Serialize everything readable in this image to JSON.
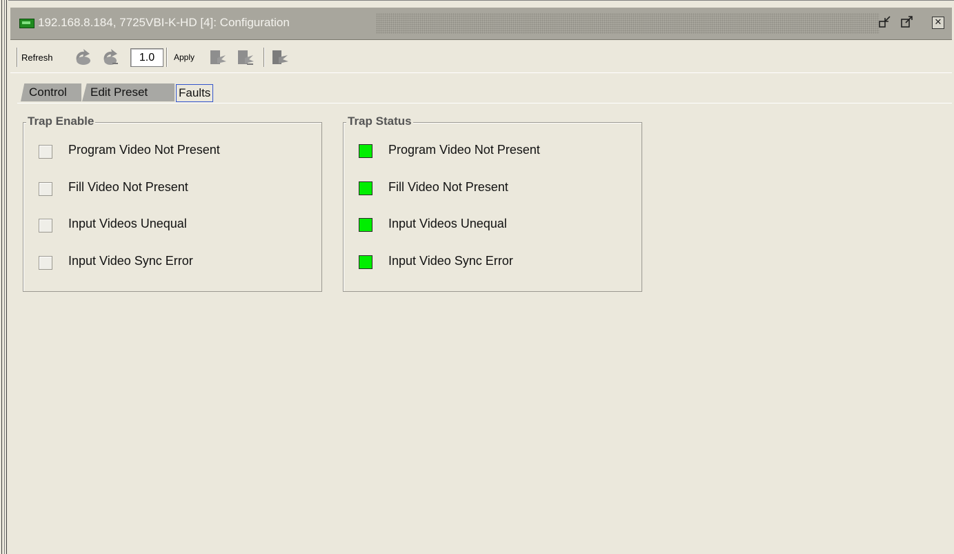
{
  "window": {
    "title": "192.168.8.184, 7725VBI-K-HD  [4]: Configuration"
  },
  "toolbar": {
    "refresh_label": "Refresh",
    "version_value": "1.0",
    "apply_label": "Apply"
  },
  "tabs": [
    {
      "label": "Control",
      "active": false
    },
    {
      "label": "Edit Preset",
      "active": false
    },
    {
      "label": "Faults",
      "active": true
    }
  ],
  "trap_enable": {
    "title": "Trap Enable",
    "items": [
      {
        "label": "Program Video Not Present",
        "checked": false
      },
      {
        "label": "Fill Video Not Present",
        "checked": false
      },
      {
        "label": "Input Videos Unequal",
        "checked": false
      },
      {
        "label": "Input Video Sync Error",
        "checked": false
      }
    ]
  },
  "trap_status": {
    "title": "Trap Status",
    "status_color": "#00ee00",
    "items": [
      {
        "label": "Program Video Not Present"
      },
      {
        "label": "Fill Video Not Present"
      },
      {
        "label": "Input Videos Unequal"
      },
      {
        "label": "Input Video Sync Error"
      }
    ]
  },
  "colors": {
    "background": "#ebe8dc",
    "titlebar": "#a8a69d",
    "ok_green": "#00ee00",
    "active_tab_border": "#3355cc"
  }
}
